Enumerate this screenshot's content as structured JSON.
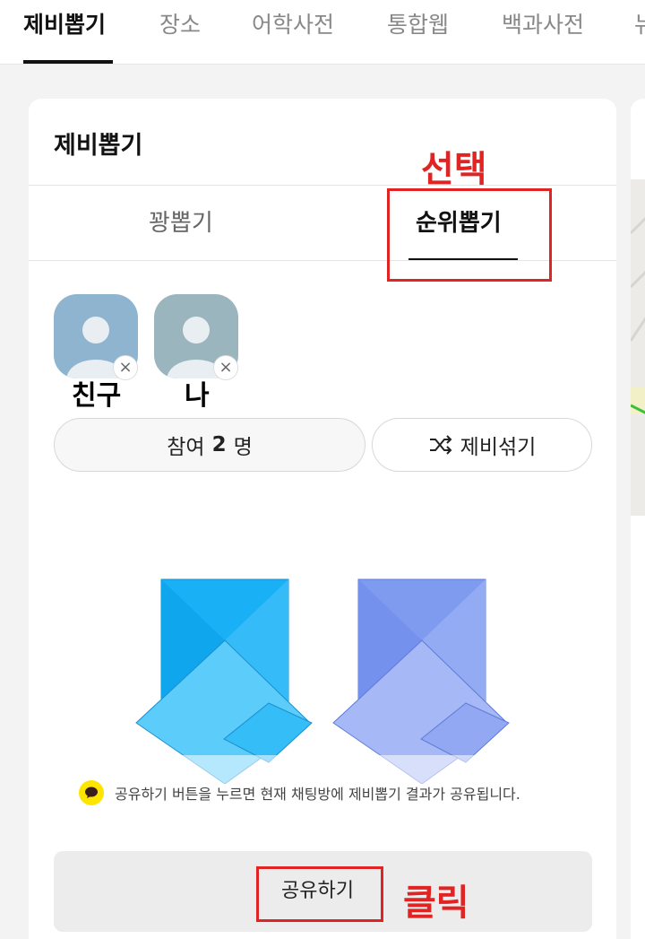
{
  "top_tabs": [
    {
      "label": "제비뽑기",
      "active": true
    },
    {
      "label": "장소",
      "active": false
    },
    {
      "label": "어학사전",
      "active": false
    },
    {
      "label": "통합웹",
      "active": false
    },
    {
      "label": "백과사전",
      "active": false
    },
    {
      "label": "뉴",
      "active": false
    }
  ],
  "card": {
    "title": "제비뽑기",
    "subtabs": [
      {
        "label": "꽝뽑기",
        "active": false
      },
      {
        "label": "순위뽑기",
        "active": true
      }
    ]
  },
  "participants": [
    {
      "name": "친구",
      "avatar_color": "#8fb4cf",
      "icon": "person-icon"
    },
    {
      "name": "나",
      "avatar_color": "#9ab5be",
      "icon": "person-icon"
    }
  ],
  "remove_symbol": "×",
  "participant_count": {
    "prefix": "참여 ",
    "count": "2",
    "suffix": "명"
  },
  "shuffle_button": {
    "label": "제비섞기",
    "icon": "shuffle-icon"
  },
  "tickets": [
    {
      "color_main": "#1ab0f5",
      "color_light": "#5ccdfb"
    },
    {
      "color_main": "#7f9bf0",
      "color_light": "#a7b8f6"
    }
  ],
  "notice": {
    "text": "공유하기 버튼을 누르면 현재 채팅방에 제비뽑기 결과가 공유됩니다.",
    "icon": "kakao-chat-icon"
  },
  "share_button": {
    "label": "공유하기"
  },
  "annotations": {
    "select": "선택",
    "click": "클릭",
    "color": "#e02424"
  }
}
